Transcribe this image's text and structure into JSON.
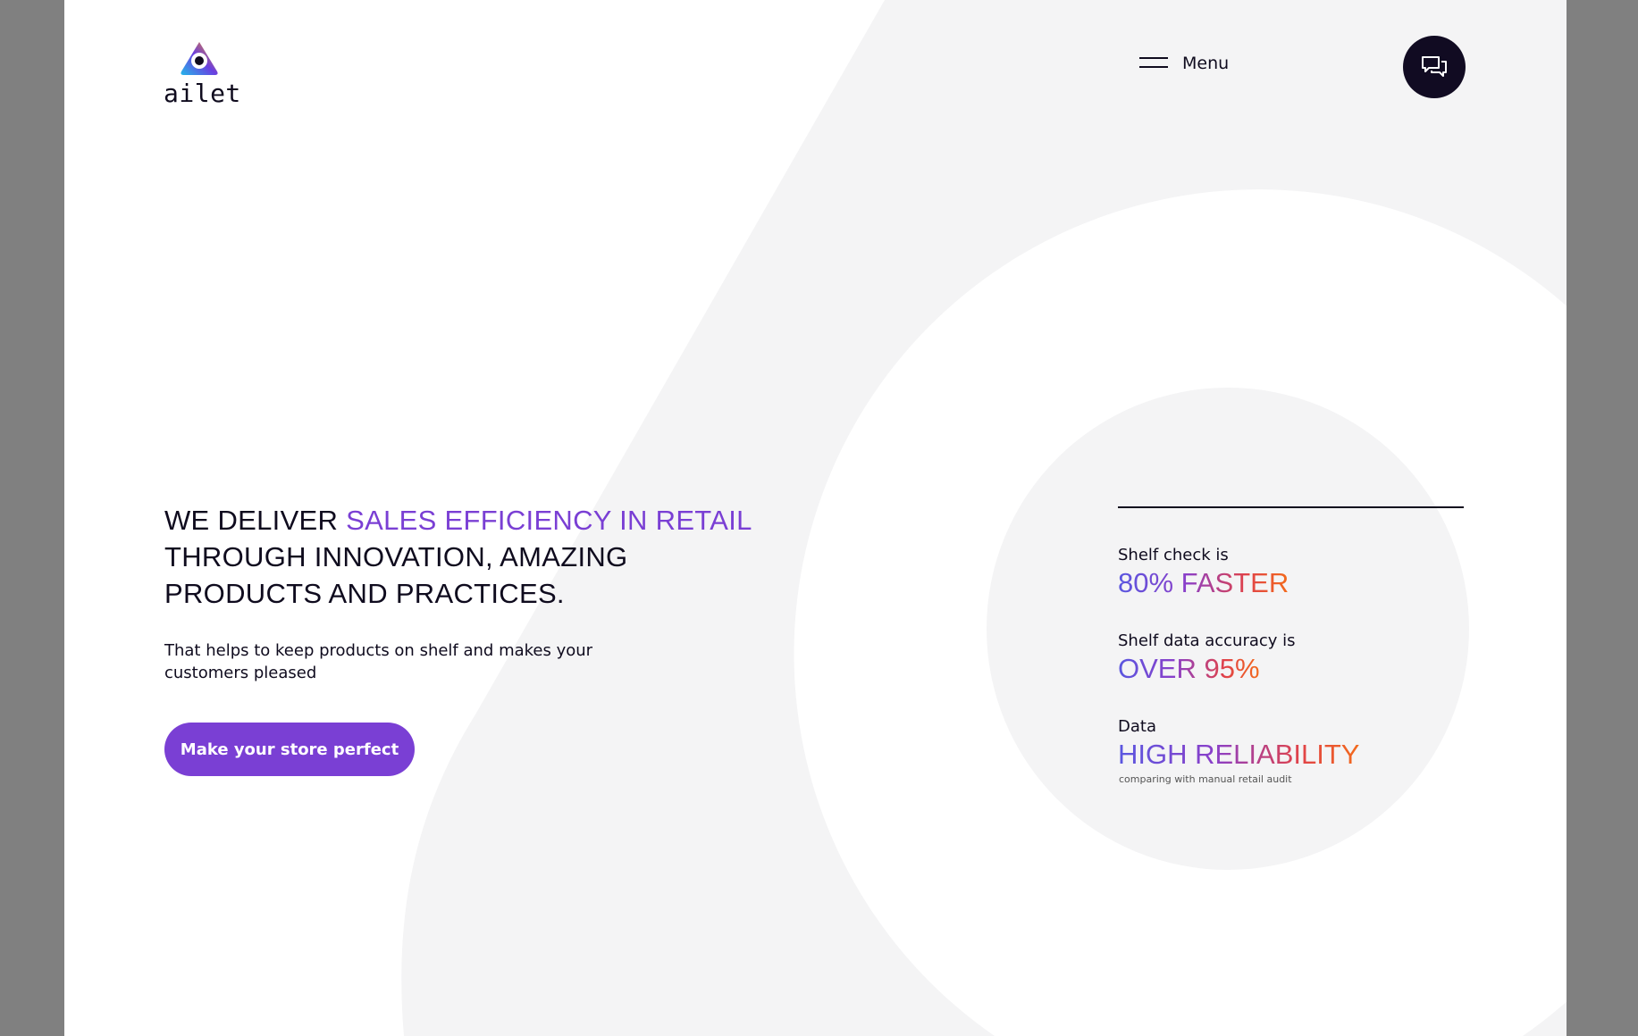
{
  "brand": {
    "name": "ailet"
  },
  "header": {
    "menu_label": "Menu"
  },
  "hero": {
    "headline_lead": "WE DELIVER ",
    "headline_accent": "SALES EFFICIENCY IN RETAIL",
    "headline_rest": "THROUGH INNOVATION, AMAZING PRODUCTS AND PRACTICES.",
    "subtext": "That helps to keep products on shelf and makes your customers pleased",
    "cta_label": "Make your store perfect"
  },
  "stats": [
    {
      "label": "Shelf check is",
      "value": "80% FASTER"
    },
    {
      "label": "Shelf data accuracy is",
      "value": "OVER 95%"
    },
    {
      "label": "Data",
      "value": "HIGH RELIABILITY",
      "note": "comparing with manual retail audit"
    }
  ],
  "colors": {
    "accent": "#7a3fd4",
    "dark": "#0f0b1e",
    "chat_button_bg": "#110b22",
    "background_shape": "#f4f4f5",
    "page_margin": "#808080"
  },
  "icons": {
    "chat": "chat-bubbles-icon",
    "menu": "hamburger-icon",
    "logo": "ailet-logo-icon"
  }
}
